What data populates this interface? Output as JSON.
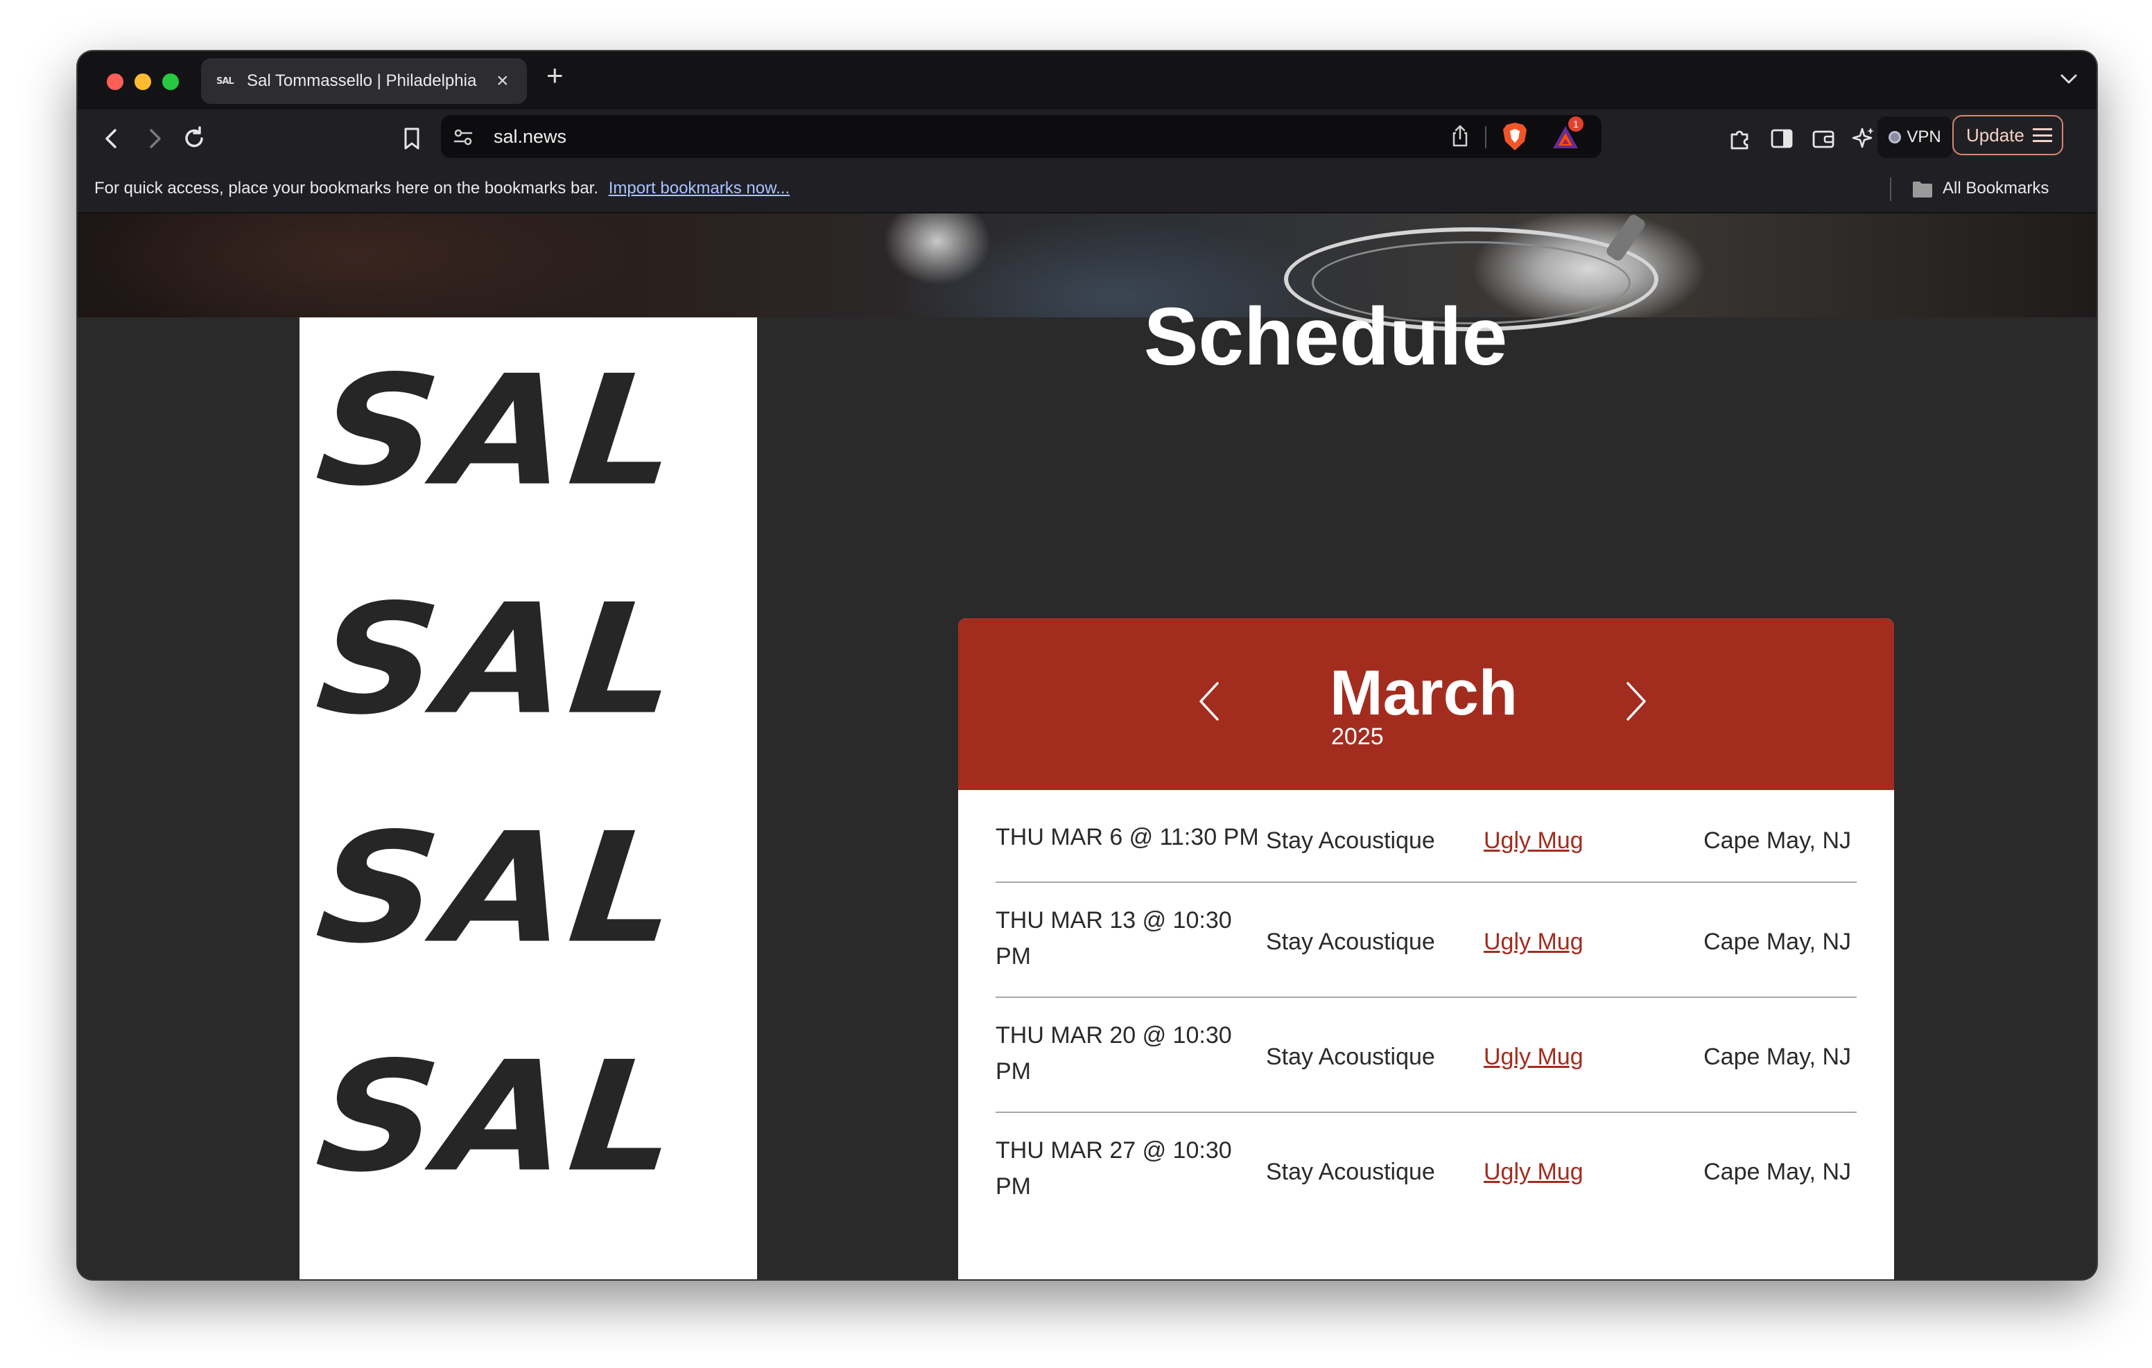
{
  "browser": {
    "tab_title": "Sal Tommassello | Philadelphia",
    "tab_favicon_text": "SAL",
    "url": "sal.news",
    "shields_badge": "1",
    "vpn_label": "VPN",
    "update_label": "Update",
    "bookmarks_bar_text": "For quick access, place your bookmarks here on the bookmarks bar.",
    "bookmarks_import_link": "Import bookmarks now...",
    "all_bookmarks_label": "All Bookmarks"
  },
  "page": {
    "logo_words": [
      "SAL",
      "SAL",
      "SAL",
      "SAL"
    ],
    "heading": "Schedule",
    "calendar": {
      "month": "March",
      "year": "2025",
      "events": [
        {
          "date": "THU MAR 6 @ 11:30 PM",
          "act": "Stay Acoustique",
          "venue": "Ugly Mug",
          "location": "Cape May, NJ"
        },
        {
          "date": "THU MAR 13 @ 10:30 PM",
          "act": "Stay Acoustique",
          "venue": "Ugly Mug",
          "location": "Cape May, NJ"
        },
        {
          "date": "THU MAR 20 @ 10:30 PM",
          "act": "Stay Acoustique",
          "venue": "Ugly Mug",
          "location": "Cape May, NJ"
        },
        {
          "date": "THU MAR 27 @ 10:30 PM",
          "act": "Stay Acoustique",
          "venue": "Ugly Mug",
          "location": "Cape May, NJ"
        }
      ]
    }
  },
  "colors": {
    "accent": "#a22d1f",
    "page_bg": "#2a2a2a",
    "logo_ink": "#262626"
  },
  "icons": [
    "back-icon",
    "forward-icon",
    "reload-icon",
    "bookmark-icon",
    "site-settings-icon",
    "share-icon",
    "brave-shields-icon",
    "brave-rewards-icon",
    "extensions-icon",
    "sidebar-icon",
    "wallet-icon",
    "leo-ai-icon",
    "folder-icon",
    "chevron-left-icon",
    "chevron-right-icon"
  ]
}
